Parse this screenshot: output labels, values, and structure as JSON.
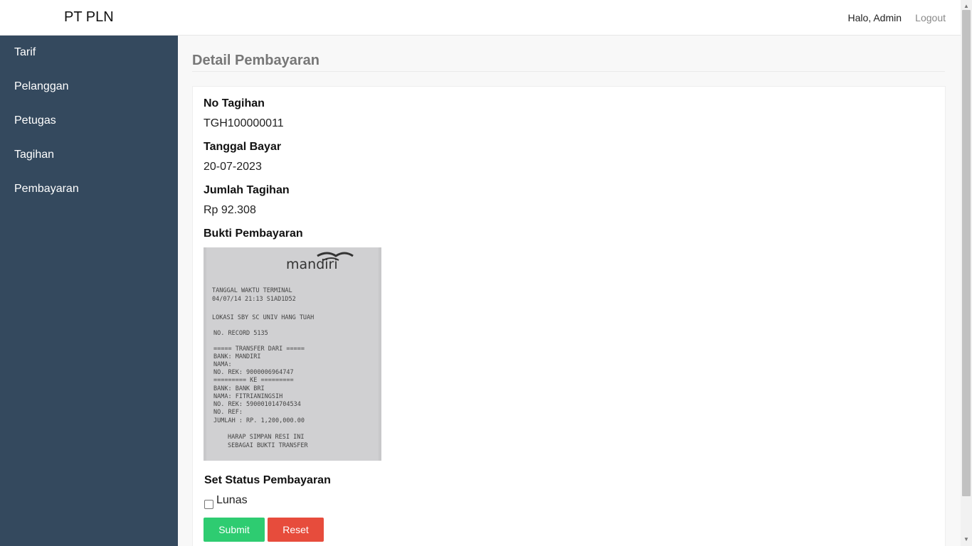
{
  "header": {
    "brand": "PT PLN",
    "greeting": "Halo, Admin",
    "logout": "Logout"
  },
  "sidebar": {
    "items": [
      {
        "label": "Tarif"
      },
      {
        "label": "Pelanggan"
      },
      {
        "label": "Petugas"
      },
      {
        "label": "Tagihan"
      },
      {
        "label": "Pembayaran"
      }
    ]
  },
  "main": {
    "title": "Detail Pembayaran",
    "fields": {
      "no_tagihan_label": "No Tagihan",
      "no_tagihan_value": "TGH100000011",
      "tanggal_bayar_label": "Tanggal Bayar",
      "tanggal_bayar_value": "20-07-2023",
      "jumlah_tagihan_label": "Jumlah Tagihan",
      "jumlah_tagihan_value": "Rp 92.308",
      "bukti_label": "Bukti Pembayaran"
    },
    "receipt": {
      "bank": "mandiri",
      "lines": [
        "TANGGAL      WAKTU      TERMINAL",
        "04/07/14     21:13      S1AD1D52",
        "LOKASI      SBY SC UNIV HANG TUAH",
        "NO. RECORD   5135",
        "===== TRANSFER DARI =====",
        "BANK: MANDIRI",
        "NAMA:",
        "NO. REK: 9000006964747",
        "========= KE =========",
        "BANK: BANK BRI",
        "NAMA: FITRIANINGSIH",
        "NO. REK: 590001014704534",
        "NO. REF:",
        "JUMLAH : RP.          1,200,000.00",
        "HARAP SIMPAN RESI INI",
        "SEBAGAI BUKTI TRANSFER"
      ]
    },
    "status": {
      "label": "Set Status Pembayaran",
      "checkbox_label": "Lunas",
      "checked": false
    },
    "buttons": {
      "submit": "Submit",
      "reset": "Reset"
    }
  },
  "colors": {
    "sidebar": "#34495e",
    "submit": "#2ecc71",
    "reset": "#e74c3c"
  }
}
